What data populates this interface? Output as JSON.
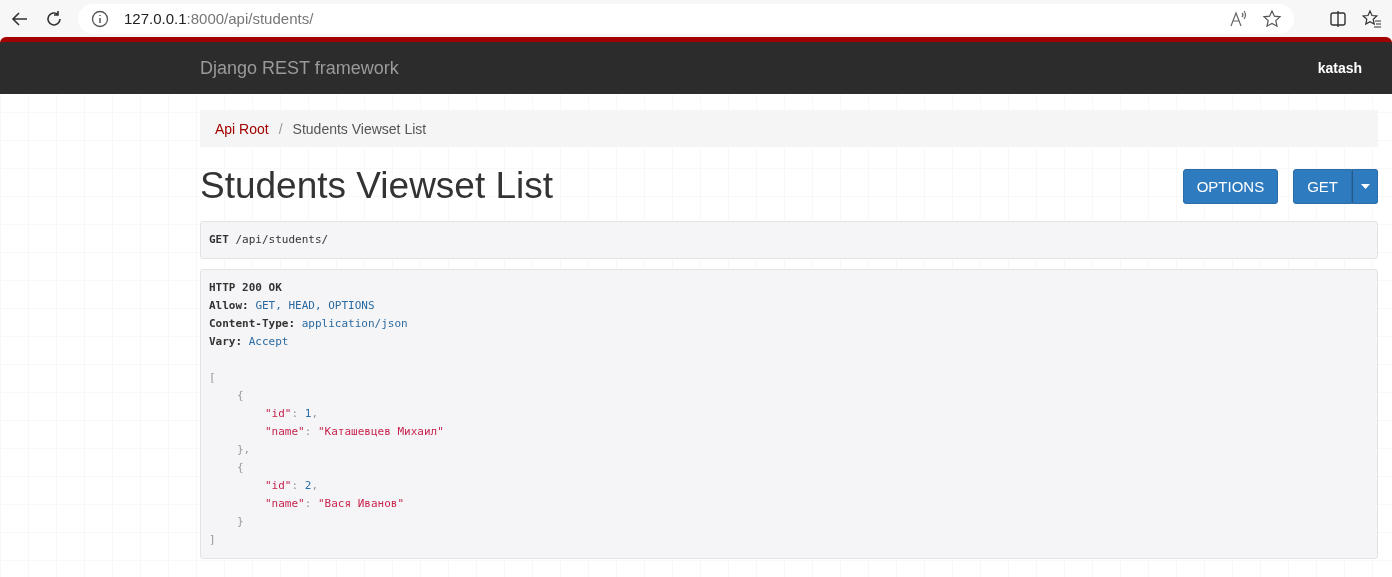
{
  "browser": {
    "url_host": "127.0.0.1",
    "url_path": ":8000/api/students/"
  },
  "navbar": {
    "brand": "Django REST framework",
    "user": "katash"
  },
  "breadcrumbs": [
    {
      "label": "Api Root",
      "link": true
    },
    {
      "label": "Students Viewset List",
      "link": false
    }
  ],
  "breadcrumb_separator": "/",
  "page_title": "Students Viewset List",
  "buttons": {
    "options": "OPTIONS",
    "get": "GET"
  },
  "request": {
    "method": "GET",
    "path": "/api/students/"
  },
  "response": {
    "status": "HTTP 200 OK",
    "headers": [
      {
        "name": "Allow:",
        "value": "GET, HEAD, OPTIONS"
      },
      {
        "name": "Content-Type:",
        "value": "application/json"
      },
      {
        "name": "Vary:",
        "value": "Accept"
      }
    ],
    "body": {
      "open": "[",
      "close": "]",
      "children": [
        {
          "open": "{",
          "close": "},",
          "fields": [
            {
              "key": "\"id\"",
              "separator": ":",
              "value": "1",
              "kind": "number",
              "trailing": ","
            },
            {
              "key": "\"name\"",
              "separator": ":",
              "value": "\"Каташевцев Михаил\"",
              "kind": "string"
            }
          ]
        },
        {
          "open": "{",
          "close": "}",
          "fields": [
            {
              "key": "\"id\"",
              "separator": ":",
              "value": "2",
              "kind": "number",
              "trailing": ","
            },
            {
              "key": "\"name\"",
              "separator": ":",
              "value": "\"Вася Иванов\"",
              "kind": "string"
            }
          ]
        }
      ]
    }
  }
}
